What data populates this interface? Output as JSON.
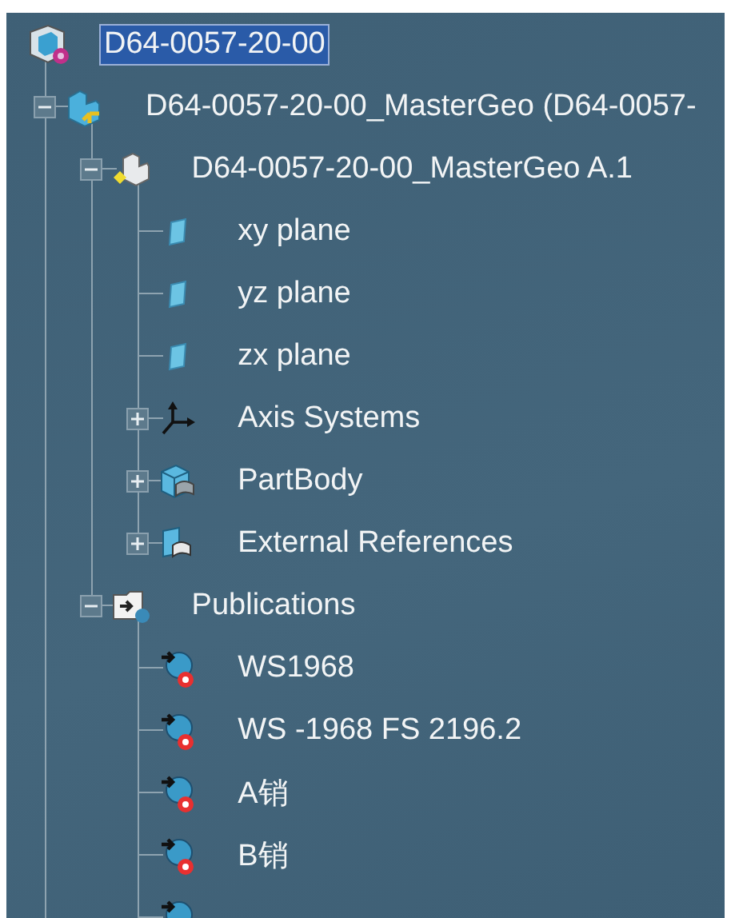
{
  "tree": {
    "label": "D64-0057-20-00",
    "kind": "product",
    "selected": true,
    "children": [
      {
        "label": "D64-0057-20-00_MasterGeo (D64-0057-",
        "kind": "part",
        "expanded": true,
        "children": [
          {
            "label": "D64-0057-20-00_MasterGeo A.1",
            "kind": "partdoc",
            "expanded": true,
            "children": [
              {
                "label": "xy plane",
                "kind": "plane"
              },
              {
                "label": "yz plane",
                "kind": "plane"
              },
              {
                "label": "zx plane",
                "kind": "plane"
              },
              {
                "label": "Axis Systems",
                "kind": "axis",
                "expanded": false
              },
              {
                "label": "PartBody",
                "kind": "body",
                "expanded": false
              },
              {
                "label": "External References",
                "kind": "extref",
                "expanded": false
              }
            ]
          },
          {
            "label": "Publications",
            "kind": "publications",
            "expanded": true,
            "children": [
              {
                "label": "WS1968",
                "kind": "publication"
              },
              {
                "label": "WS -1968 FS 2196.2",
                "kind": "publication"
              },
              {
                "label": "A销",
                "kind": "publication"
              },
              {
                "label": "B销",
                "kind": "publication"
              },
              {
                "kind": "publication"
              }
            ]
          }
        ]
      }
    ]
  }
}
